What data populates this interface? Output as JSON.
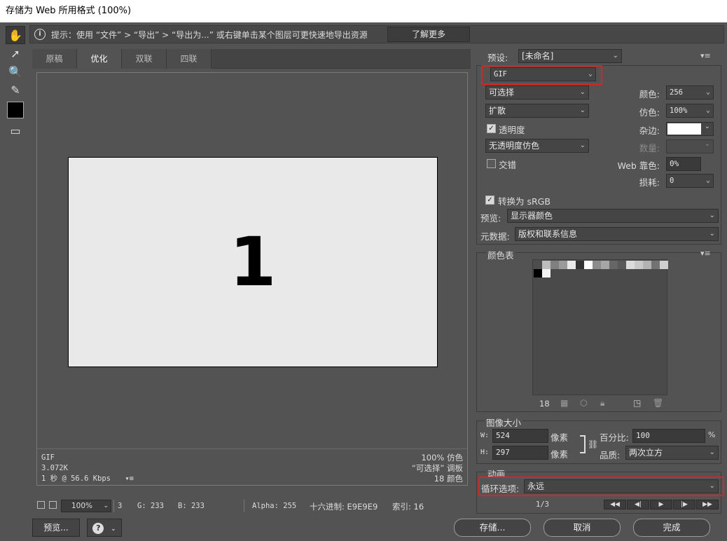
{
  "window": {
    "title": "存储为 Web 所用格式 (100%)"
  },
  "tools": [
    "hand-icon",
    "slice-select-icon",
    "zoom-icon",
    "eyedropper-icon",
    "color-swatch",
    "toggle-slices-icon"
  ],
  "tip": {
    "icon": "i",
    "text": "提示：使用 “文件” > “导出” > “导出为...” 或右键单击某个图层可更快速地导出资源",
    "learn_more": "了解更多"
  },
  "tabs": [
    "原稿",
    "优化",
    "双联",
    "四联"
  ],
  "preview": {
    "image_text": "1",
    "info_left": [
      "GIF",
      "3.072K",
      "1 秒 @ 56.6 Kbps"
    ],
    "info_right": [
      "100% 仿色",
      "“可选择” 调板",
      "18 颜色"
    ],
    "menu_glyph": "▾≡"
  },
  "status": {
    "zoom": "100%",
    "frame": "3",
    "g": "G: 233",
    "b": "B: 233",
    "alpha": "Alpha: 255",
    "hex": "十六进制: E9E9E9",
    "index": "索引: 16"
  },
  "bottom": {
    "preview_btn": "预览...",
    "help_glyph": "?",
    "save_btn": "存储...",
    "cancel_btn": "取消",
    "done_btn": "完成"
  },
  "settings": {
    "preset_label": "预设:",
    "preset_value": "[未命名]",
    "format": "GIF",
    "reduction": "可选择",
    "dither_algo": "扩散",
    "transparency_label": "透明度",
    "transparency_checked": true,
    "matte_dither": "无透明度仿色",
    "interlace_label": "交错",
    "interlace_checked": false,
    "colors_label": "颜色:",
    "colors_value": "256",
    "dither_label": "仿色:",
    "dither_value": "100%",
    "matte_label": "杂边:",
    "amount_label": "数量:",
    "websnap_label": "Web 靠色:",
    "websnap_value": "0%",
    "lossy_label": "损耗:",
    "lossy_value": "0",
    "convert_label": "转换为 sRGB",
    "convert_checked": true,
    "preview_label": "预览:",
    "preview_value": "显示器颜色",
    "metadata_label": "元数据:",
    "metadata_value": "版权和联系信息"
  },
  "color_table": {
    "title": "颜色表",
    "count": "18",
    "colors": [
      "#4d4d4d",
      "#bdbdbd",
      "#808080",
      "#9a9a9a",
      "#e9e9e9",
      "#333333",
      "#ffffff",
      "#8c8c8c",
      "#a6a6a6",
      "#666666",
      "#595959",
      "#dcdcdc",
      "#c9c9c9",
      "#b3b3b3",
      "#737373",
      "#d0d0d0",
      "#000000",
      "#f2f2f2"
    ]
  },
  "image_size": {
    "title": "图像大小",
    "w_label": "W:",
    "w_value": "524",
    "h_label": "H:",
    "h_value": "297",
    "unit": "像素",
    "percent_label": "百分比:",
    "percent_value": "100",
    "percent_unit": "%",
    "quality_label": "品质:",
    "quality_value": "两次立方"
  },
  "animation": {
    "title": "动画",
    "loop_label": "循环选项:",
    "loop_value": "永远",
    "frame_counter": "1/3"
  },
  "accent": {
    "highlight": "#e4201c"
  }
}
